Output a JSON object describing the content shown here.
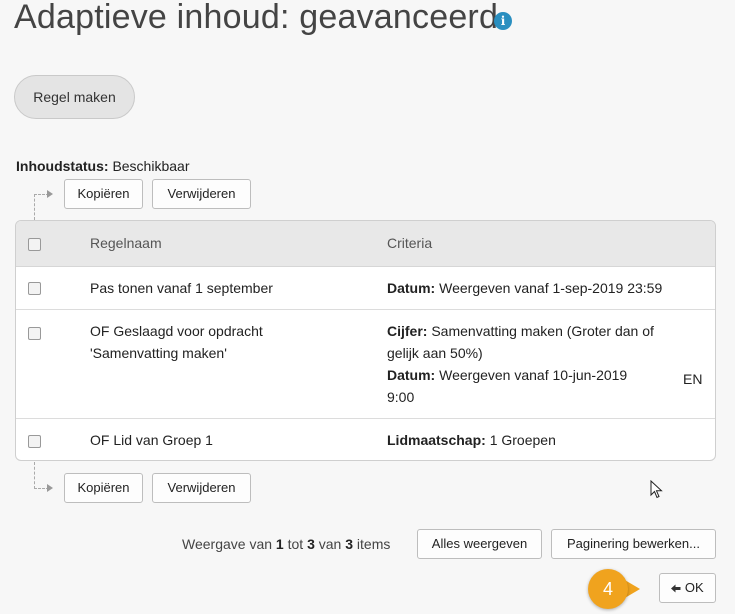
{
  "page": {
    "title": "Adaptieve inhoud: geavanceerd",
    "info_icon": "info-icon"
  },
  "toolbar": {
    "create_rule_label": "Regel maken"
  },
  "status": {
    "label": "Inhoudstatus:",
    "value": "Beschikbaar"
  },
  "bulk_actions": {
    "copy_label": "Kopiëren",
    "delete_label": "Verwijderen"
  },
  "table": {
    "headers": [
      "Regelnaam",
      "Criteria"
    ],
    "rows": [
      {
        "name": "Pas tonen vanaf 1 september",
        "criteria": [
          {
            "label": "Datum:",
            "text": "Weergeven vanaf 1-sep-2019 23:59"
          }
        ]
      },
      {
        "name_line1": "OF Geslaagd voor opdracht",
        "name_line2": "'Samenvatting maken'",
        "criteria": [
          {
            "label": "Cijfer:",
            "text": "Samenvatting maken (Groter dan of",
            "text2": "gelijk aan 50%)"
          },
          {
            "label": "Datum:",
            "text": "Weergeven vanaf 10-jun-2019",
            "text2": "9:00"
          }
        ],
        "lang_badge": "EN"
      },
      {
        "name": "OF Lid van Groep 1",
        "criteria": [
          {
            "label": "Lidmaatschap:",
            "text": "1 Groepen"
          }
        ]
      }
    ]
  },
  "pagination": {
    "prefix": "Weergave van",
    "from": "1",
    "to_word": "tot",
    "to": "3",
    "of_word": "van",
    "total": "3",
    "suffix": "items",
    "show_all_label": "Alles weergeven",
    "edit_paging_label": "Paginering bewerken..."
  },
  "callout": {
    "step_number": "4"
  },
  "footer": {
    "ok_label": "OK",
    "ok_icon": "back-arrow-icon"
  },
  "colors": {
    "info_blue": "#2a8fc0",
    "callout_orange": "#f0a31e",
    "header_bg": "#e8e8e8"
  }
}
